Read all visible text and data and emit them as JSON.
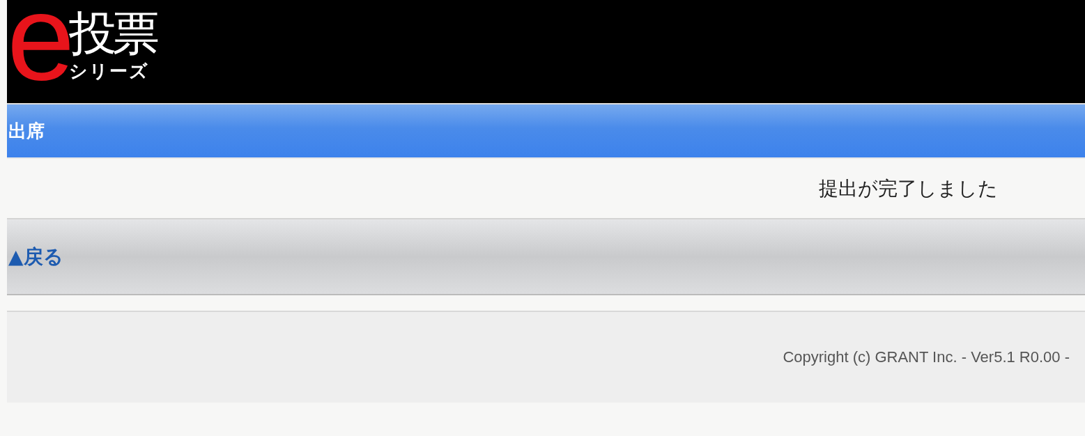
{
  "logo": {
    "mark": "e",
    "title": "投票",
    "subtitle": "シリーズ"
  },
  "page_title": "出席",
  "message": "提出が完了しました",
  "back_link": "▲戻る",
  "footer": "Copyright (c) GRANT Inc. - Ver5.1 R0.00 -"
}
